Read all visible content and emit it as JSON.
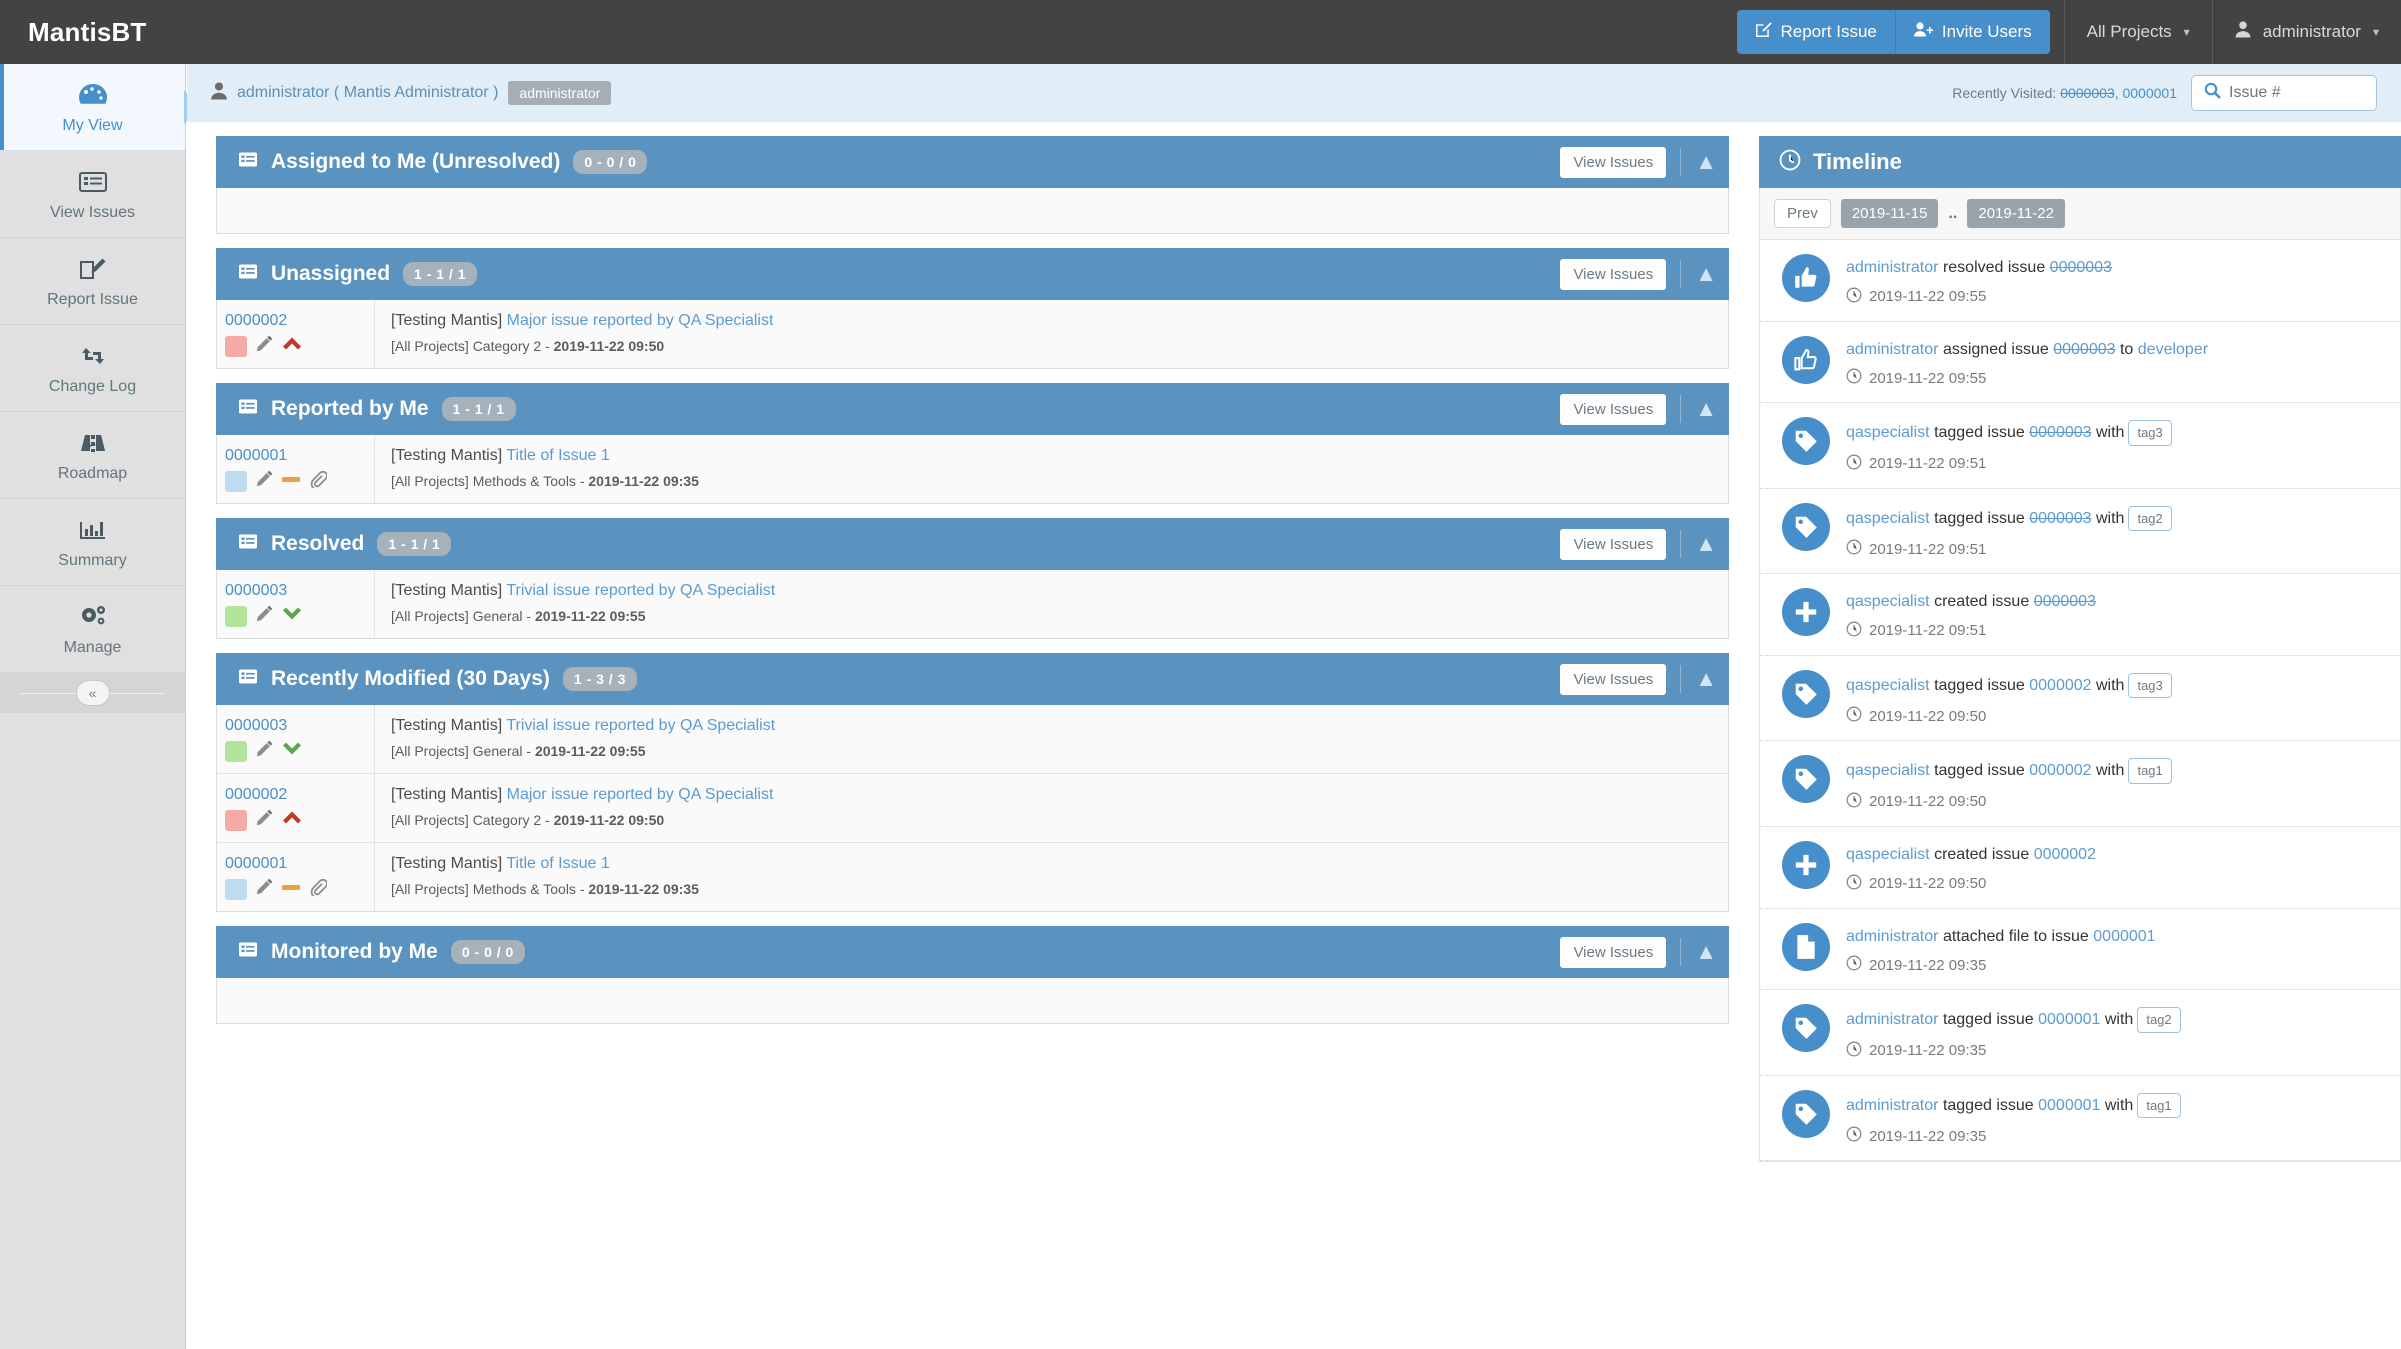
{
  "app": {
    "brand": "MantisBT"
  },
  "header": {
    "report_issue": "Report Issue",
    "invite_users": "Invite Users",
    "project_selector": "All Projects",
    "user_menu": "administrator"
  },
  "breadcrumb": {
    "user": "administrator ( Mantis Administrator )",
    "access_badge": "administrator",
    "recently_visited_label": "Recently Visited:",
    "recently_visited": [
      {
        "id": "0000003",
        "struck": true
      },
      {
        "id": "0000001",
        "struck": false
      }
    ],
    "search_placeholder": "Issue #"
  },
  "sidebar": {
    "items": [
      {
        "label": "My View",
        "icon": "dashboard-icon",
        "active": true
      },
      {
        "label": "View Issues",
        "icon": "list-icon",
        "active": false
      },
      {
        "label": "Report Issue",
        "icon": "edit-icon",
        "active": false
      },
      {
        "label": "Change Log",
        "icon": "retweet-icon",
        "active": false
      },
      {
        "label": "Roadmap",
        "icon": "road-icon",
        "active": false
      },
      {
        "label": "Summary",
        "icon": "bar-chart-icon",
        "active": false
      },
      {
        "label": "Manage",
        "icon": "gears-icon",
        "active": false
      }
    ],
    "collapse_label": "«"
  },
  "main": {
    "view_issues_label": "View Issues",
    "panels": [
      {
        "title": "Assigned to Me (Unresolved)",
        "count": "0 - 0 / 0",
        "rows": []
      },
      {
        "title": "Unassigned",
        "count": "1 - 1 / 1",
        "rows": [
          {
            "id": "0000002",
            "color": "#f5a9a9",
            "severity_icon": "chevron-up-icon",
            "severity_color": "#c0392b",
            "attachment": false,
            "project": "[Testing Mantis]",
            "summary": "Major issue reported by QA Specialist",
            "meta_prefix": "[All Projects] Category 2 - ",
            "meta_date": "2019-11-22 09:50"
          }
        ]
      },
      {
        "title": "Reported by Me",
        "count": "1 - 1 / 1",
        "rows": [
          {
            "id": "0000001",
            "color": "#bedcf0",
            "severity_icon": "minus-icon",
            "severity_color": "#e8a33d",
            "attachment": true,
            "project": "[Testing Mantis]",
            "summary": "Title of Issue 1",
            "meta_prefix": "[All Projects] Methods & Tools - ",
            "meta_date": "2019-11-22 09:35"
          }
        ]
      },
      {
        "title": "Resolved",
        "count": "1 - 1 / 1",
        "rows": [
          {
            "id": "0000003",
            "color": "#b2e59b",
            "severity_icon": "chevron-down-icon",
            "severity_color": "#5ca64c",
            "attachment": false,
            "project": "[Testing Mantis]",
            "summary": "Trivial issue reported by QA Specialist",
            "meta_prefix": "[All Projects] General - ",
            "meta_date": "2019-11-22 09:55"
          }
        ]
      },
      {
        "title": "Recently Modified (30 Days)",
        "count": "1 - 3 / 3",
        "rows": [
          {
            "id": "0000003",
            "color": "#b2e59b",
            "severity_icon": "chevron-down-icon",
            "severity_color": "#5ca64c",
            "attachment": false,
            "project": "[Testing Mantis]",
            "summary": "Trivial issue reported by QA Specialist",
            "meta_prefix": "[All Projects] General - ",
            "meta_date": "2019-11-22 09:55"
          },
          {
            "id": "0000002",
            "color": "#f5a9a9",
            "severity_icon": "chevron-up-icon",
            "severity_color": "#c0392b",
            "attachment": false,
            "project": "[Testing Mantis]",
            "summary": "Major issue reported by QA Specialist",
            "meta_prefix": "[All Projects] Category 2 - ",
            "meta_date": "2019-11-22 09:50"
          },
          {
            "id": "0000001",
            "color": "#bedcf0",
            "severity_icon": "minus-icon",
            "severity_color": "#e8a33d",
            "attachment": true,
            "project": "[Testing Mantis]",
            "summary": "Title of Issue 1",
            "meta_prefix": "[All Projects] Methods & Tools - ",
            "meta_date": "2019-11-22 09:35"
          }
        ]
      },
      {
        "title": "Monitored by Me",
        "count": "0 - 0 / 0",
        "rows": []
      }
    ]
  },
  "timeline": {
    "title": "Timeline",
    "prev_label": "Prev",
    "date_from": "2019-11-15",
    "date_sep": "..",
    "date_to": "2019-11-22",
    "events": [
      {
        "icon": "thumbs-up-solid-icon",
        "actor": "administrator",
        "verb": "resolved issue",
        "issue": "0000003",
        "issue_struck": true,
        "suffix": "",
        "target": "",
        "tag": "",
        "time": "2019-11-22 09:55"
      },
      {
        "icon": "thumbs-up-outline-icon",
        "actor": "administrator",
        "verb": "assigned issue",
        "issue": "0000003",
        "issue_struck": true,
        "suffix": "to",
        "target": "developer",
        "tag": "",
        "time": "2019-11-22 09:55"
      },
      {
        "icon": "tag-icon",
        "actor": "qaspecialist",
        "verb": "tagged issue",
        "issue": "0000003",
        "issue_struck": true,
        "suffix": "with",
        "target": "",
        "tag": "tag3",
        "time": "2019-11-22 09:51"
      },
      {
        "icon": "tag-icon",
        "actor": "qaspecialist",
        "verb": "tagged issue",
        "issue": "0000003",
        "issue_struck": true,
        "suffix": "with",
        "target": "",
        "tag": "tag2",
        "time": "2019-11-22 09:51"
      },
      {
        "icon": "plus-icon",
        "actor": "qaspecialist",
        "verb": "created issue",
        "issue": "0000003",
        "issue_struck": true,
        "suffix": "",
        "target": "",
        "tag": "",
        "time": "2019-11-22 09:51"
      },
      {
        "icon": "tag-icon",
        "actor": "qaspecialist",
        "verb": "tagged issue",
        "issue": "0000002",
        "issue_struck": false,
        "suffix": "with",
        "target": "",
        "tag": "tag3",
        "time": "2019-11-22 09:50"
      },
      {
        "icon": "tag-icon",
        "actor": "qaspecialist",
        "verb": "tagged issue",
        "issue": "0000002",
        "issue_struck": false,
        "suffix": "with",
        "target": "",
        "tag": "tag1",
        "time": "2019-11-22 09:50"
      },
      {
        "icon": "plus-icon",
        "actor": "qaspecialist",
        "verb": "created issue",
        "issue": "0000002",
        "issue_struck": false,
        "suffix": "",
        "target": "",
        "tag": "",
        "time": "2019-11-22 09:50"
      },
      {
        "icon": "file-icon",
        "actor": "administrator",
        "verb": "attached file to issue",
        "issue": "0000001",
        "issue_struck": false,
        "suffix": "",
        "target": "",
        "tag": "",
        "time": "2019-11-22 09:35"
      },
      {
        "icon": "tag-icon",
        "actor": "administrator",
        "verb": "tagged issue",
        "issue": "0000001",
        "issue_struck": false,
        "suffix": "with",
        "target": "",
        "tag": "tag2",
        "time": "2019-11-22 09:35"
      },
      {
        "icon": "tag-icon",
        "actor": "administrator",
        "verb": "tagged issue",
        "issue": "0000001",
        "issue_struck": false,
        "suffix": "with",
        "target": "",
        "tag": "tag1",
        "time": "2019-11-22 09:35"
      }
    ]
  },
  "colors": {
    "accent": "#478fca",
    "panel_header": "#5a92c0",
    "topnav": "#434343"
  }
}
